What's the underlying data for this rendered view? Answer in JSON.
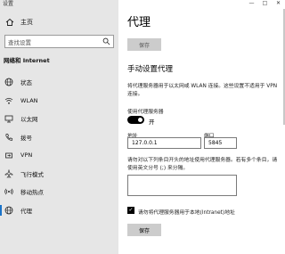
{
  "window": {
    "title": "设置",
    "minimize": "—",
    "maximize": "□",
    "close": "✕"
  },
  "sidebar": {
    "home_label": "主页",
    "search_placeholder": "查找设置",
    "section_title": "网络和 Internet",
    "items": [
      {
        "label": "状态",
        "icon": "globe-icon"
      },
      {
        "label": "WLAN",
        "icon": "wifi-icon"
      },
      {
        "label": "以太网",
        "icon": "ethernet-icon"
      },
      {
        "label": "拨号",
        "icon": "dialup-icon"
      },
      {
        "label": "VPN",
        "icon": "vpn-icon"
      },
      {
        "label": "飞行模式",
        "icon": "airplane-icon"
      },
      {
        "label": "移动热点",
        "icon": "hotspot-icon"
      },
      {
        "label": "代理",
        "icon": "proxy-globe-icon",
        "active": true
      }
    ]
  },
  "main": {
    "title": "代理",
    "save_top": "保存",
    "manual_heading": "手动设置代理",
    "manual_desc": "将代理服务器用于以太网或 WLAN 连接。这些设置不适用于 VPN 连接。",
    "use_proxy_label": "使用代理服务器",
    "toggle_state": "开",
    "address_label": "地址",
    "address_value": "127.0.0.1",
    "port_label": "端口",
    "port_value": "5845",
    "exceptions_desc": "请勿对以下列条目开头的地址使用代理服务器。若有多个条目，请使用英文分号 (;) 来分隔。",
    "exceptions_value": "",
    "local_checkbox_label": "请勿将代理服务器用于本地(Intranet)地址",
    "local_checked": true,
    "save_bottom": "保存"
  },
  "colors": {
    "sidebar_bg": "#e6e6e6",
    "accent": "#1a73c8",
    "button_bg": "#cccccc"
  }
}
